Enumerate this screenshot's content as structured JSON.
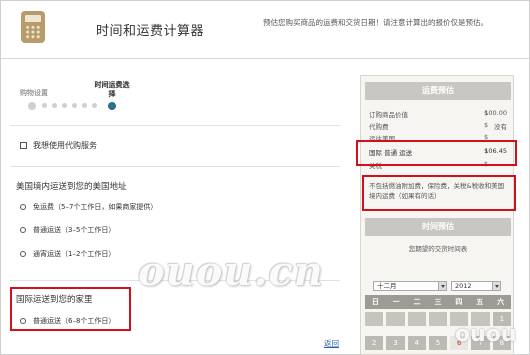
{
  "header": {
    "title": "时间和运费计算器",
    "note": "预估您购买商品的运费和交货日期！请注意计算出的报价仅是预估。"
  },
  "steps": {
    "items": [
      {
        "label": "购物设置"
      },
      {
        "label": "时间运费选择"
      }
    ]
  },
  "proxy_service": {
    "label": "我想使用代购服务",
    "checked": false
  },
  "us_shipping": {
    "title": "美国境内运送到您的美国地址",
    "options": [
      {
        "label": "免运费（5–7个工作日，如果商家提供）"
      },
      {
        "label": "普通运送（3–5个工作日）"
      },
      {
        "label": "通宵运送（1–2个工作日）"
      }
    ]
  },
  "intl_shipping": {
    "title": "国际运送到您的家里",
    "options": [
      {
        "label": "普通运送（6–8个工作日）"
      }
    ]
  },
  "back_link": "返回",
  "estimate": {
    "title": "运费预估",
    "items": [
      {
        "label": "订购商品价值",
        "currency": "$",
        "amount": "100.00"
      },
      {
        "label": "代购费",
        "currency": "$",
        "amount": "没有"
      },
      {
        "label": "运往美国",
        "currency": "$",
        "amount": ""
      },
      {
        "label": "国际 普通 运送",
        "currency": "$",
        "amount": "106.45"
      },
      {
        "label": "关税",
        "currency": "$",
        "amount": ""
      }
    ],
    "note": "不包括燃油附加费，保险费，关税&税收和美国境内运费（如果有的话）"
  },
  "delivery": {
    "title": "时间预估",
    "hint": "您期望的交货时间表",
    "month": "十二月",
    "year": "2012",
    "weekdays": [
      "日",
      "一",
      "二",
      "三",
      "四",
      "五",
      "六"
    ],
    "days": [
      "",
      "",
      "",
      "",
      "",
      "",
      "1",
      "2",
      "3",
      "4",
      "5",
      "6",
      "7",
      "8"
    ]
  },
  "watermark": "ouou.cn",
  "watermark_small": "ouou"
}
